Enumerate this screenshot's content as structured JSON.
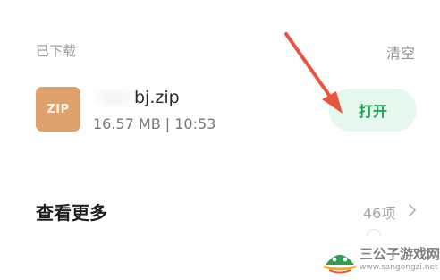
{
  "section": {
    "downloaded_label": "已下载",
    "clear_label": "清空"
  },
  "file": {
    "icon_text": "ZIP",
    "name_visible": "bj.zip",
    "size_time": "16.57 MB | 10:53",
    "open_label": "打开"
  },
  "view_more": {
    "label": "查看更多",
    "count": "46项"
  },
  "watermark": {
    "title": "三公子游戏网",
    "url": "www.sangongzi.net"
  },
  "colors": {
    "accent_green": "#1fa35a",
    "button_bg": "#e6f7ee",
    "zip_icon": "#e0a26c",
    "arrow": "#e8553f"
  }
}
